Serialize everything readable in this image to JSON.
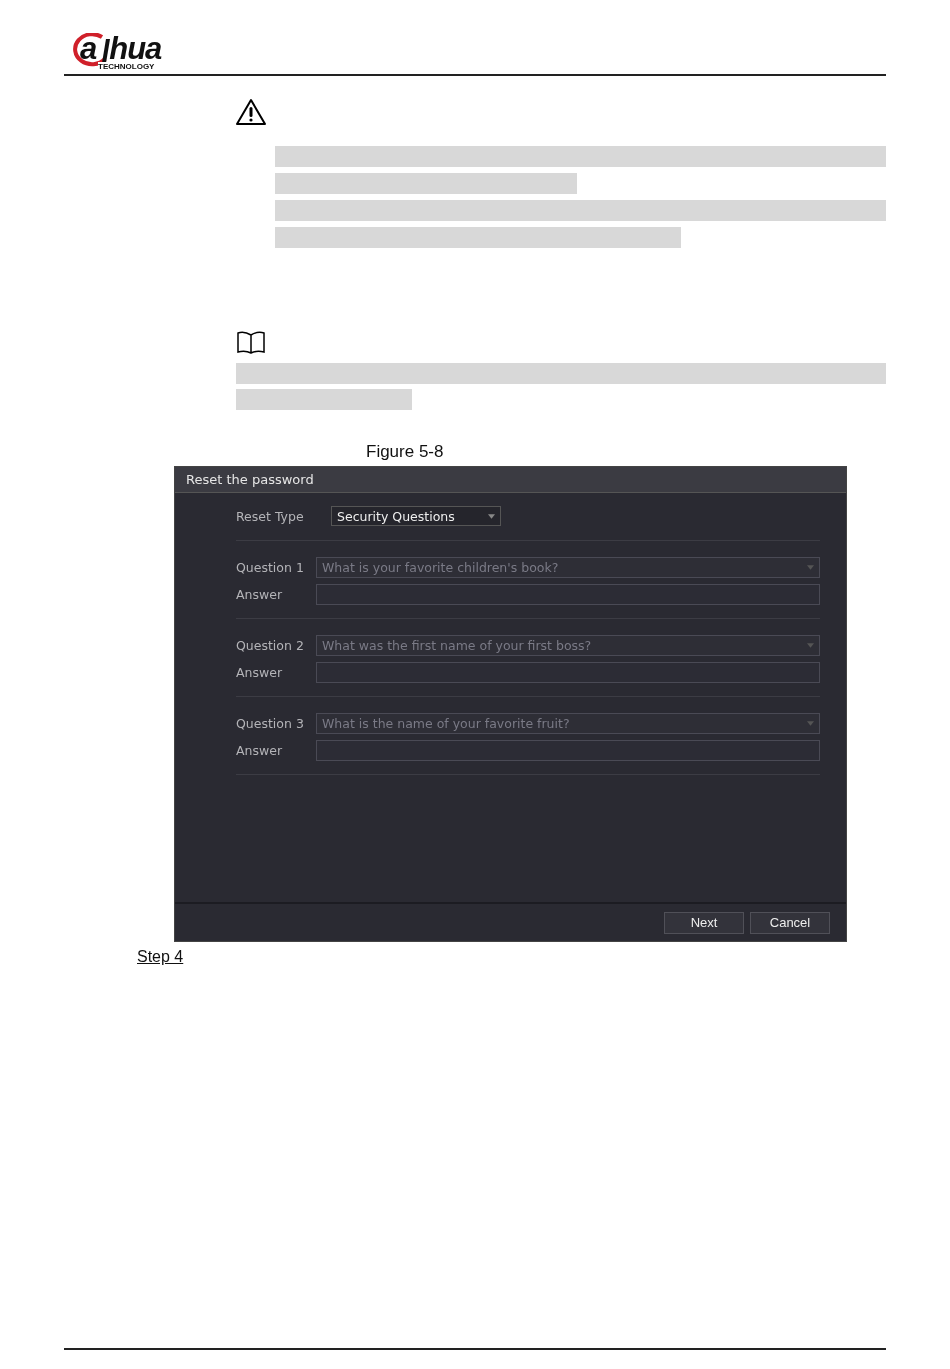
{
  "header": {
    "logo": {
      "letter": "a",
      "rest": "hua",
      "tagline": "TECHNOLOGY"
    }
  },
  "figure": {
    "caption": "Figure 5-8"
  },
  "dialog": {
    "title": "Reset the password",
    "reset_type": {
      "label": "Reset Type",
      "value": "Security Questions"
    },
    "questions": [
      {
        "label": "Question 1",
        "question": "What is your favorite children's book?",
        "answer_label": "Answer"
      },
      {
        "label": "Question 2",
        "question": "What was the first name of your first boss?",
        "answer_label": "Answer"
      },
      {
        "label": "Question 3",
        "question": "What is the name of your favorite fruit?",
        "answer_label": "Answer"
      }
    ],
    "buttons": [
      "Next",
      "Cancel"
    ]
  },
  "step": "Step 4"
}
